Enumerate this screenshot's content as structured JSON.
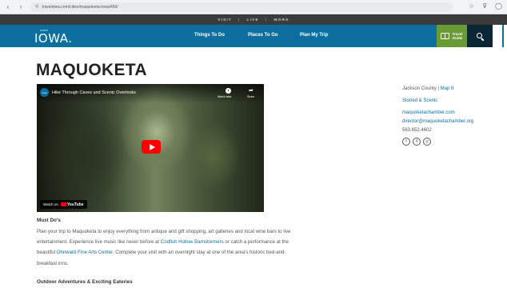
{
  "browser": {
    "url": "traveliowa.com/cities/maquoketa-iowa/456/",
    "back": "‹",
    "forward": "›",
    "reload": "↻",
    "lock": "⚲",
    "star": "☆",
    "extensions": "⊽",
    "profile": "◯"
  },
  "utility_nav": {
    "items": [
      "VISIT",
      "LIVE",
      "WORK"
    ],
    "separator": "|"
  },
  "header": {
    "logo_small": "travel",
    "logo": "IOWA.",
    "nav": [
      "Things To Do",
      "Places To Go",
      "Plan My Trip"
    ],
    "travel_guide": [
      "Travel",
      "Guide"
    ]
  },
  "page": {
    "title": "MAQUOKETA"
  },
  "video": {
    "channel": "iowa",
    "title": "Hike Through Caves and Scenic Overlooks",
    "watch_later": "Watch later",
    "share": "Share",
    "share_glyph": "➦",
    "watch_on": "Watch on",
    "youtube": "YouTube"
  },
  "sidebar": {
    "county": "Jackson County |",
    "map_link": "Map It",
    "category": "Storied & Scenic",
    "website": "maquoketachamber.com",
    "email": "director@maquoketachamber.org",
    "phone": "563.652.4602",
    "social": [
      "f",
      "X",
      "◎"
    ]
  },
  "content": {
    "must_dos_heading": "Must Do's",
    "p1": "Plan your trip to Maquoketa to enjoy everything from antique and gift shopping, art galleries and local wine bars to live entertainment. Experience live music like never before at ",
    "link1": "Codfish Hollow Barnstormers",
    "p2": " or catch a performance at the beautiful ",
    "link2": "Ohnward Fine Arts Center",
    "p3": ". Complete your visit with an overnight stay at one of the area's historic bed-and-breakfast inns.",
    "outdoor_heading": "Outdoor Adventures & Exciting Eateries"
  }
}
